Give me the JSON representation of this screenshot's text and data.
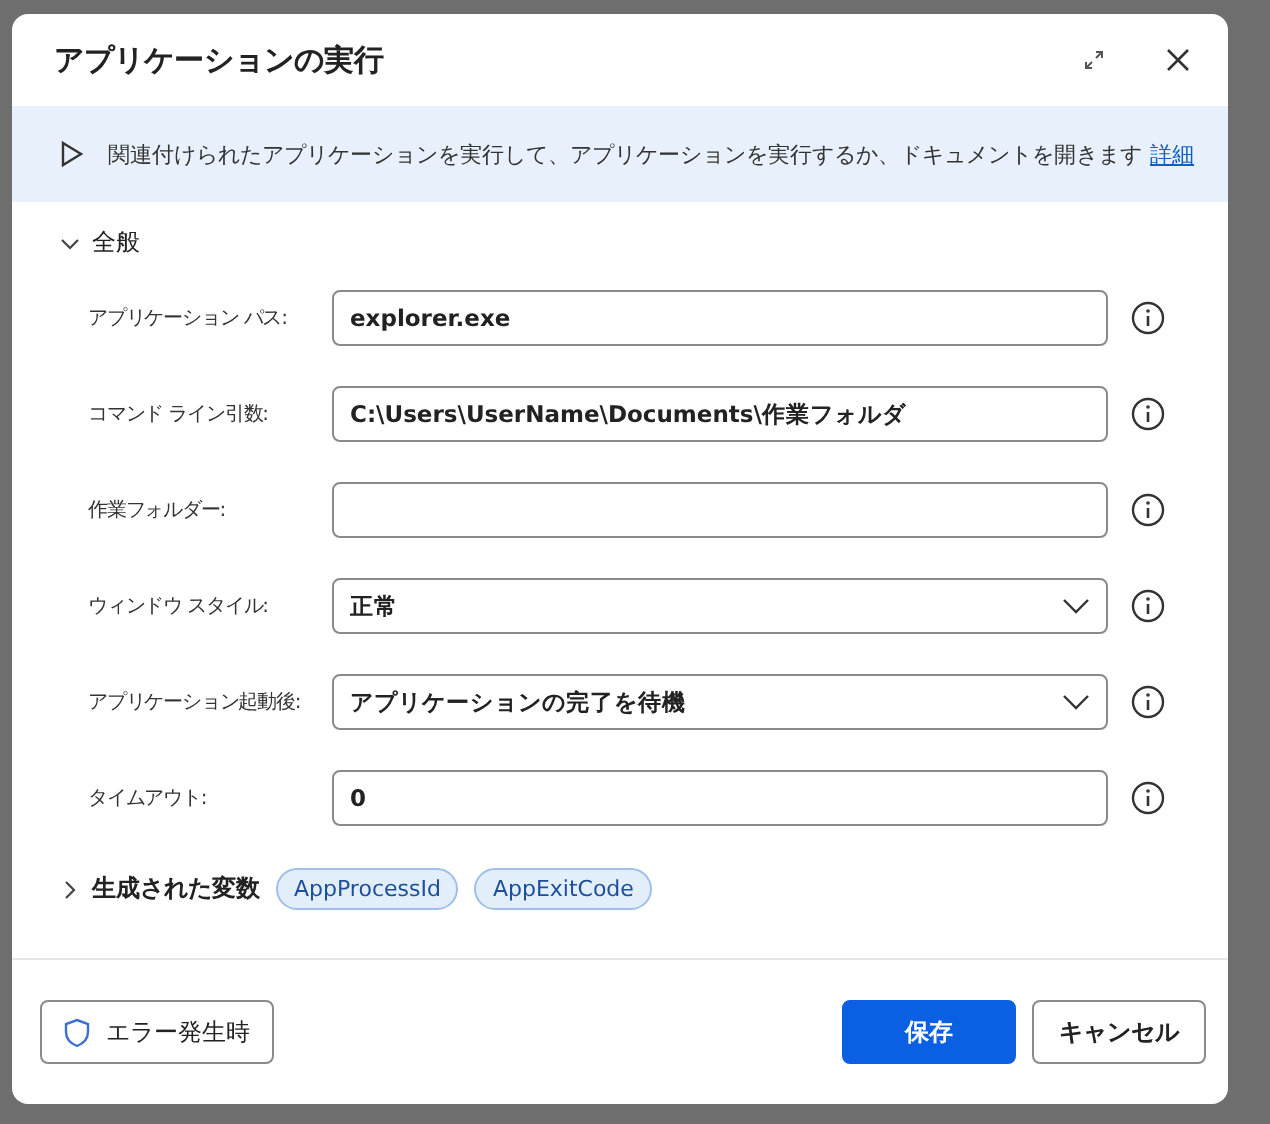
{
  "dialog": {
    "title": "アプリケーションの実行"
  },
  "banner": {
    "text": "関連付けられたアプリケーションを実行して、アプリケーションを実行するか、ドキュメントを開きます",
    "link": "詳細"
  },
  "section": {
    "title": "全般",
    "expanded": true
  },
  "fields": [
    {
      "label": "アプリケーション パス:",
      "kind": "text",
      "value": "explorer.exe"
    },
    {
      "label": "コマンド ライン引数:",
      "kind": "text",
      "value": "C:\\Users\\UserName\\Documents\\作業フォルダ"
    },
    {
      "label": "作業フォルダー:",
      "kind": "text"
    },
    {
      "label": "ウィンドウ スタイル:",
      "kind": "dropdown",
      "value": "正常"
    },
    {
      "label": "アプリケーション起動後:",
      "kind": "dropdown",
      "value": "アプリケーションの完了を待機"
    },
    {
      "label": "タイムアウト:",
      "kind": "text",
      "value": "0"
    }
  ],
  "variables": {
    "title": "生成された変数",
    "expanded": false,
    "items": [
      "AppProcessId",
      "AppExitCode"
    ]
  },
  "footer": {
    "error_button": "エラー発生時",
    "save_button": "保存",
    "cancel_button": "キャンセル"
  }
}
